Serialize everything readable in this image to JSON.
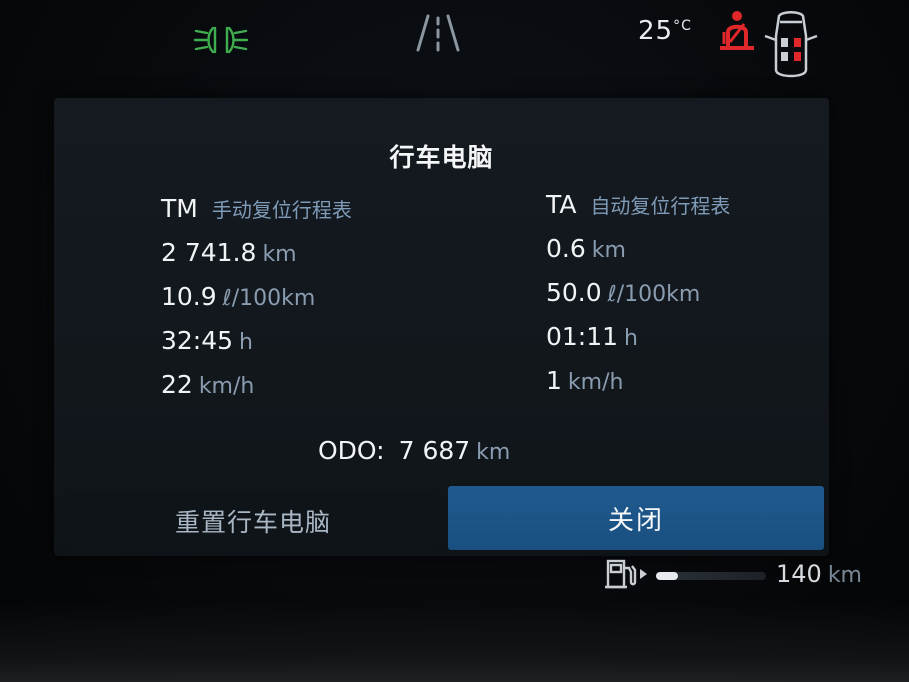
{
  "status": {
    "temperature": "25",
    "temperature_unit": "°C"
  },
  "panel": {
    "title": "行车电脑",
    "left": {
      "abbr": "TM",
      "label": "手动复位行程表",
      "rows": [
        {
          "value": "2 741.8",
          "unit": "km"
        },
        {
          "value": "10.9",
          "unit": "ℓ/100km"
        },
        {
          "value": "32:45",
          "unit": "h"
        },
        {
          "value": "22",
          "unit": "km/h"
        }
      ]
    },
    "right": {
      "abbr": "TA",
      "label": "自动复位行程表",
      "rows": [
        {
          "value": "0.6",
          "unit": "km"
        },
        {
          "value": "50.0",
          "unit": "ℓ/100km"
        },
        {
          "value": "01:11",
          "unit": "h"
        },
        {
          "value": "1",
          "unit": "km/h"
        }
      ]
    },
    "odo": {
      "label": "ODO:",
      "value": "7 687",
      "unit": "km"
    },
    "reset_button": "重置行车电脑",
    "close_button": "关闭"
  },
  "fuel": {
    "range_value": "140",
    "range_unit": "km",
    "level_fraction": 0.2
  },
  "colors": {
    "accent_button": "#1f5a8f",
    "headlight_indicator": "#3fae4f",
    "seatbelt_warning": "#e0282a",
    "label_blue": "#7f9bb8"
  },
  "icons": {
    "headlight": "headlight-icon",
    "lane": "lane-assist-icon",
    "seatbelt": "seatbelt-warning-icon",
    "car": "car-doors-icon",
    "fuel": "fuel-pump-icon"
  }
}
